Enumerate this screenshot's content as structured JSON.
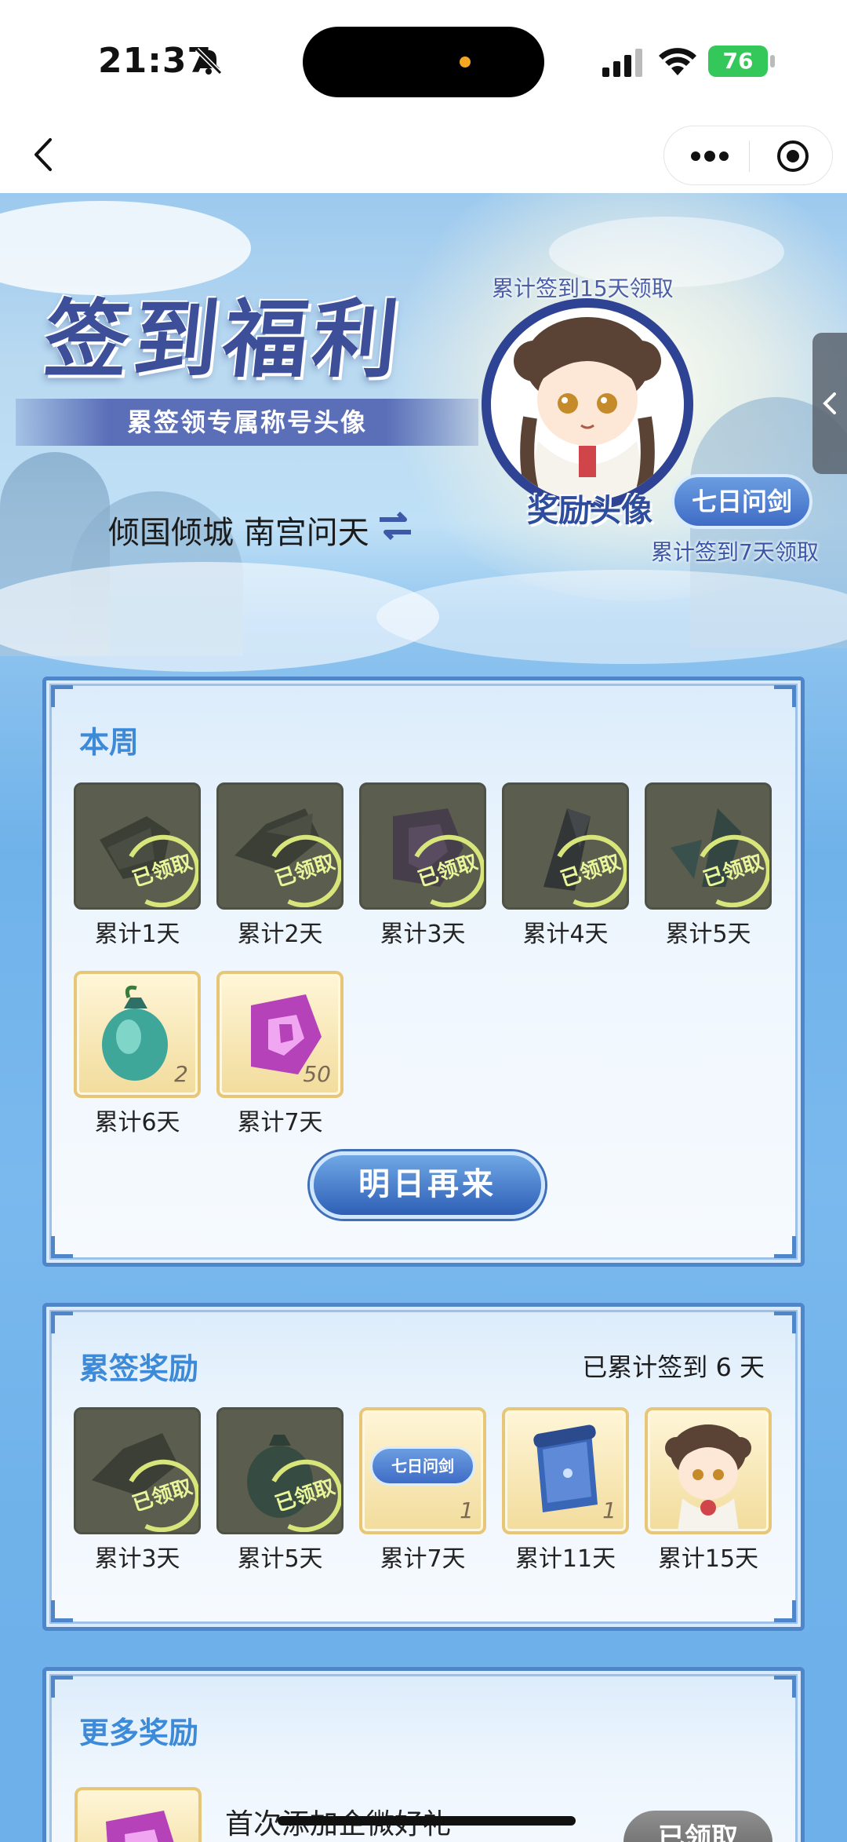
{
  "status_bar": {
    "time": "21:37",
    "battery": "76"
  },
  "header": {
    "more_icon": "more-dots-icon",
    "close_icon": "target-icon",
    "back_icon": "chevron-left-icon"
  },
  "banner": {
    "title": "签到福利",
    "subtitle": "累签领专属称号头像",
    "player_name": "倾国倾城 南宫问天",
    "avatar_top_label": "累计签到15天领取",
    "avatar_label": "奖励头像",
    "title_badge": "七日问剑",
    "title_badge_sub": "累计签到7天领取"
  },
  "weekly": {
    "title": "本周",
    "stamp_text": "已领取",
    "items": [
      {
        "label": "累计1天",
        "state": "claimed",
        "icon": "material-icon"
      },
      {
        "label": "累计2天",
        "state": "claimed",
        "icon": "material-icon"
      },
      {
        "label": "累计3天",
        "state": "claimed",
        "icon": "purple-gem-icon"
      },
      {
        "label": "累计4天",
        "state": "claimed",
        "icon": "dark-crystal-icon"
      },
      {
        "label": "累计5天",
        "state": "claimed",
        "icon": "green-crystal-icon"
      },
      {
        "label": "累计6天",
        "state": "available",
        "icon": "jade-pouch-icon",
        "qty": "2"
      },
      {
        "label": "累计7天",
        "state": "available",
        "icon": "purple-gem-icon",
        "qty": "50"
      }
    ],
    "button": "明日再来"
  },
  "cumulative": {
    "title": "累签奖励",
    "progress_text": "已累计签到 6 天",
    "stamp_text": "已领取",
    "items": [
      {
        "label": "累计3天",
        "state": "claimed",
        "icon": "material-icon"
      },
      {
        "label": "累计5天",
        "state": "claimed",
        "icon": "jade-pouch-icon"
      },
      {
        "label": "累计7天",
        "state": "available",
        "icon": "title-badge-icon",
        "badge": "七日问剑",
        "qty": "1"
      },
      {
        "label": "累计11天",
        "state": "available",
        "icon": "scroll-icon",
        "qty": "1"
      },
      {
        "label": "累计15天",
        "state": "available",
        "icon": "avatar-icon"
      }
    ]
  },
  "more": {
    "title": "更多奖励",
    "item_text": "首次添加企微好礼",
    "button": "已领取"
  },
  "colors": {
    "accent": "#3d8ad8",
    "panel_border": "#4f86c9",
    "title": "#3e4f9a",
    "claimed_stamp": "#e8f59a"
  }
}
